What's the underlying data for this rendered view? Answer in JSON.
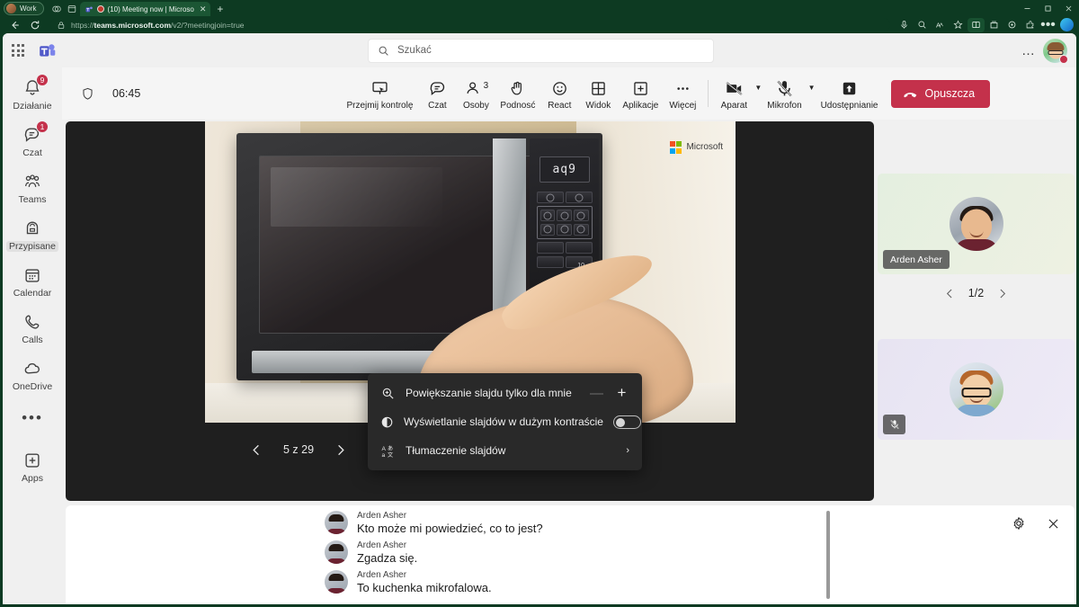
{
  "browser": {
    "profile_label": "Work",
    "tab_title": "(10) Meeting now | Microso",
    "new_tab_label": "+",
    "url_prefix": "https://",
    "url_bold": "teams.microsoft.com",
    "url_rest": "/v2/?meetingjoin=true",
    "window_minimize": "–",
    "window_maximize": "⬜",
    "window_close": "✕"
  },
  "teams_header": {
    "search_placeholder": "Szukać",
    "more_label": "…"
  },
  "rail": {
    "items": [
      {
        "label": "Działanie",
        "icon": "bell-icon",
        "badge": "9"
      },
      {
        "label": "Czat",
        "icon": "chat-icon",
        "badge": "1"
      },
      {
        "label": "Teams",
        "icon": "teams-icon",
        "badge": ""
      },
      {
        "label": "Przypisane",
        "icon": "backpack-icon",
        "badge": ""
      },
      {
        "label": "Calendar",
        "icon": "calendar-icon",
        "badge": ""
      },
      {
        "label": "Calls",
        "icon": "phone-icon",
        "badge": ""
      },
      {
        "label": "OneDrive",
        "icon": "cloud-icon",
        "badge": ""
      }
    ],
    "more_label": "•••",
    "apps_label": "Apps"
  },
  "meeting": {
    "timer": "06:45",
    "tools": [
      {
        "label": "Przejmij kontrolę",
        "icon": "take-control-icon",
        "count": ""
      },
      {
        "label": "Czat",
        "icon": "chat-bubble-icon",
        "count": ""
      },
      {
        "label": "Osoby",
        "icon": "people-icon",
        "count": "3"
      },
      {
        "label": "Podnosć",
        "icon": "raise-hand-icon",
        "count": ""
      },
      {
        "label": "React",
        "icon": "emoji-icon",
        "count": ""
      },
      {
        "label": "Widok",
        "icon": "view-grid-icon",
        "count": ""
      },
      {
        "label": "Aplikacje",
        "icon": "apps-plus-icon",
        "count": ""
      },
      {
        "label": "Więcej",
        "icon": "more-dots-icon",
        "count": ""
      }
    ],
    "camera_label": "Aparat",
    "mic_label": "Mikrofon",
    "share_label": "Udostępnianie",
    "leave_label": "Opuszcza",
    "leave_color": "#c4314b"
  },
  "slide": {
    "microsoft_label": "Microsoft",
    "display_text": "aq9",
    "key_number": "10",
    "counter": "5 z 29",
    "prev_label": "‹",
    "next_label": "›"
  },
  "context_menu": {
    "items": [
      {
        "label": "Powiększanie slajdu tylko dla mnie",
        "icon": "zoom-in-icon",
        "control": "stepper",
        "minus": "—",
        "plus": "+"
      },
      {
        "label": "Wyświetlanie slajdów w dużym kontraście",
        "icon": "contrast-icon",
        "control": "toggle",
        "toggle_on": false
      },
      {
        "label": "Tłumaczenie slajdów",
        "icon": "translate-icon",
        "control": "submenu",
        "arrow": "›"
      }
    ]
  },
  "participants": {
    "tile_one_name": "Arden Asher",
    "pager": "1/2",
    "prev_label": "‹",
    "next_label": "›",
    "tile_two_muted": true
  },
  "chat": {
    "settings_icon": "gear-icon",
    "close_icon": "close-icon",
    "messages": [
      {
        "name": "Arden Asher",
        "text": "Kto może mi powiedzieć, co to jest?"
      },
      {
        "name": "Arden Asher",
        "text": "Zgadza się."
      },
      {
        "name": "Arden Asher",
        "text": "To kuchenka mikrofalowa."
      }
    ]
  }
}
